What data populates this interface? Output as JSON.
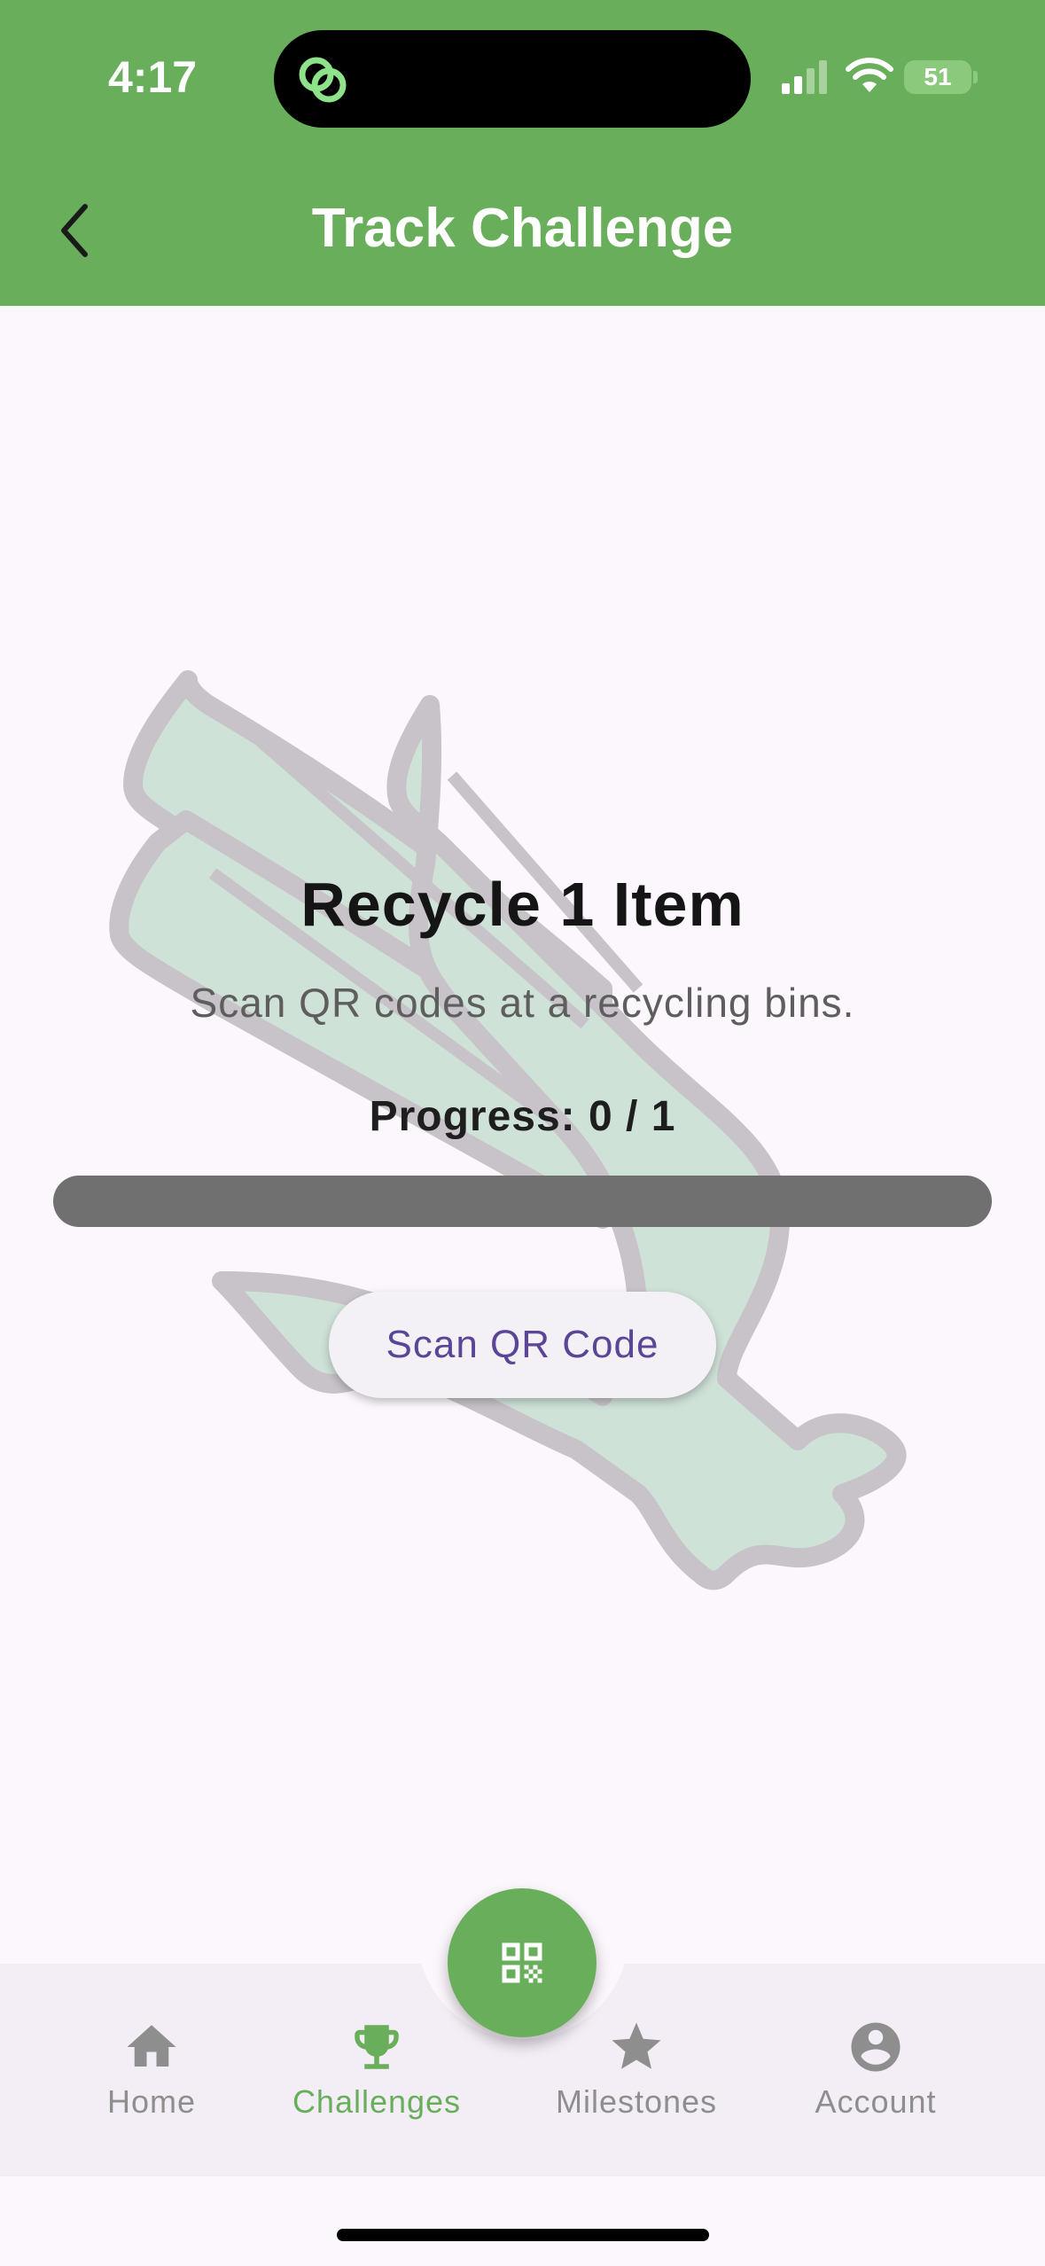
{
  "status_bar": {
    "time": "4:17",
    "battery": "51"
  },
  "header": {
    "title": "Track Challenge",
    "back_icon": "chevron-left-icon"
  },
  "challenge": {
    "title": "Recycle 1 Item",
    "description": "Scan QR codes at a recycling bins.",
    "progress_label": "Progress: 0 / 1",
    "progress_current": 0,
    "progress_total": 1,
    "scan_button_label": "Scan QR Code"
  },
  "fab": {
    "icon": "qr-code-icon"
  },
  "bottom_nav": {
    "items": [
      {
        "label": "Home",
        "icon": "home-icon",
        "active": false
      },
      {
        "label": "Challenges",
        "icon": "trophy-icon",
        "active": true
      },
      {
        "label": "Milestones",
        "icon": "star-icon",
        "active": false
      },
      {
        "label": "Account",
        "icon": "account-circle-icon",
        "active": false
      }
    ]
  },
  "colors": {
    "brand_green": "#69ae5b",
    "accent_purple": "#5b4596",
    "progress_track": "#707070",
    "inactive_nav": "#8e8e8e"
  }
}
